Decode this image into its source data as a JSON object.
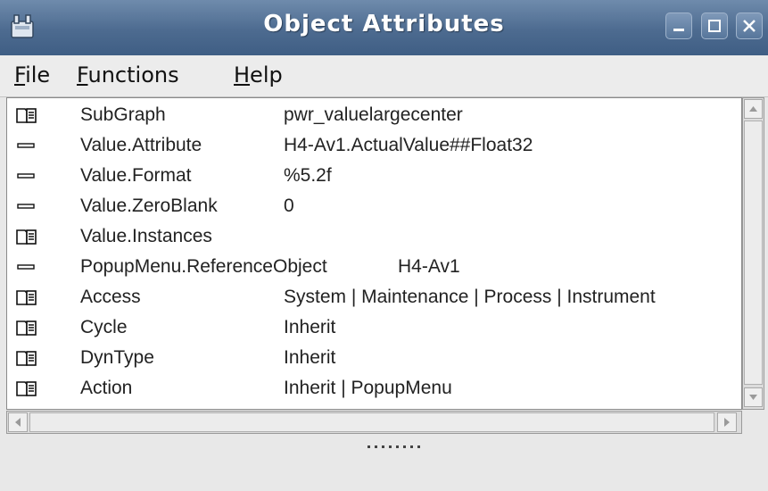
{
  "window": {
    "title": "Object Attributes",
    "title_color": "#ffffff",
    "titlebar_color": "#4d6b90"
  },
  "menu": {
    "file": {
      "mnemonic": "F",
      "rest": "ile"
    },
    "functions": {
      "mnemonic": "F",
      "rest": "unctions"
    },
    "help": {
      "mnemonic": "H",
      "rest": "elp"
    }
  },
  "attributes": [
    {
      "icon": "folder-icon",
      "name": "SubGraph",
      "value": "pwr_valuelargecenter"
    },
    {
      "icon": "dash-icon",
      "name": "Value.Attribute",
      "value": "H4-Av1.ActualValue##Float32"
    },
    {
      "icon": "dash-icon",
      "name": "Value.Format",
      "value": "%5.2f"
    },
    {
      "icon": "dash-icon",
      "name": "Value.ZeroBlank",
      "value": "0"
    },
    {
      "icon": "folder-icon",
      "name": "Value.Instances",
      "value": ""
    },
    {
      "icon": "dash-icon",
      "name": "PopupMenu.ReferenceObject",
      "value": "H4-Av1"
    },
    {
      "icon": "folder-icon",
      "name": "Access",
      "value": "System | Maintenance | Process | Instrument"
    },
    {
      "icon": "folder-icon",
      "name": "Cycle",
      "value": "Inherit"
    },
    {
      "icon": "folder-icon",
      "name": "DynType",
      "value": "Inherit"
    },
    {
      "icon": "folder-icon",
      "name": "Action",
      "value": "Inherit | PopupMenu"
    }
  ]
}
